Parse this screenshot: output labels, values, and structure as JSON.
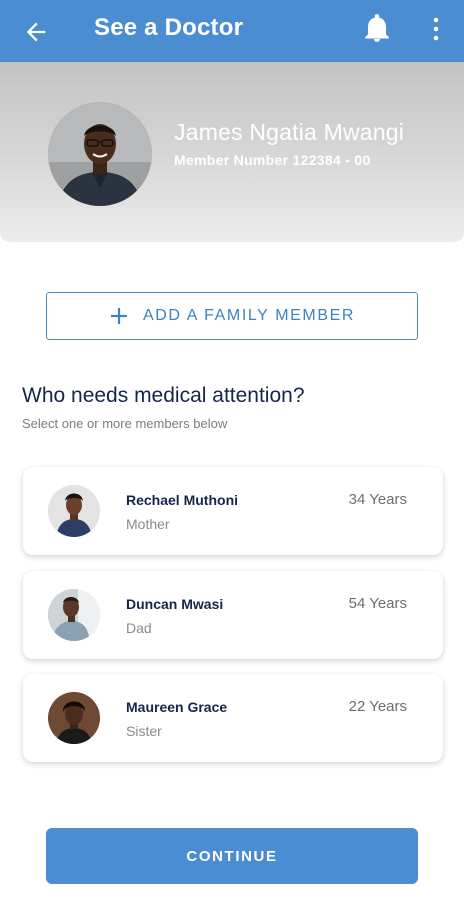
{
  "appbar": {
    "title": "See a Doctor",
    "back_icon": "arrow-left-icon",
    "bell_icon": "bell-icon",
    "more_icon": "more-vertical-icon",
    "color": "#4a8dd1"
  },
  "profile": {
    "name": "James Ngatia Mwangi",
    "member_number": "Member Number 122384 - 00"
  },
  "add_family_button": {
    "label": "ADD A FAMILY MEMBER",
    "icon": "plus-icon"
  },
  "prompt": {
    "question": "Who needs medical attention?",
    "hint": "Select one or more members below"
  },
  "members": [
    {
      "name": "Rechael Muthoni",
      "relation": "Mother",
      "age": "34 Years"
    },
    {
      "name": "Duncan Mwasi",
      "relation": "Dad",
      "age": "54 Years"
    },
    {
      "name": "Maureen Grace",
      "relation": "Sister",
      "age": "22 Years"
    }
  ],
  "continue_button": {
    "label": "CONTINUE",
    "color": "#4a8dd1"
  }
}
